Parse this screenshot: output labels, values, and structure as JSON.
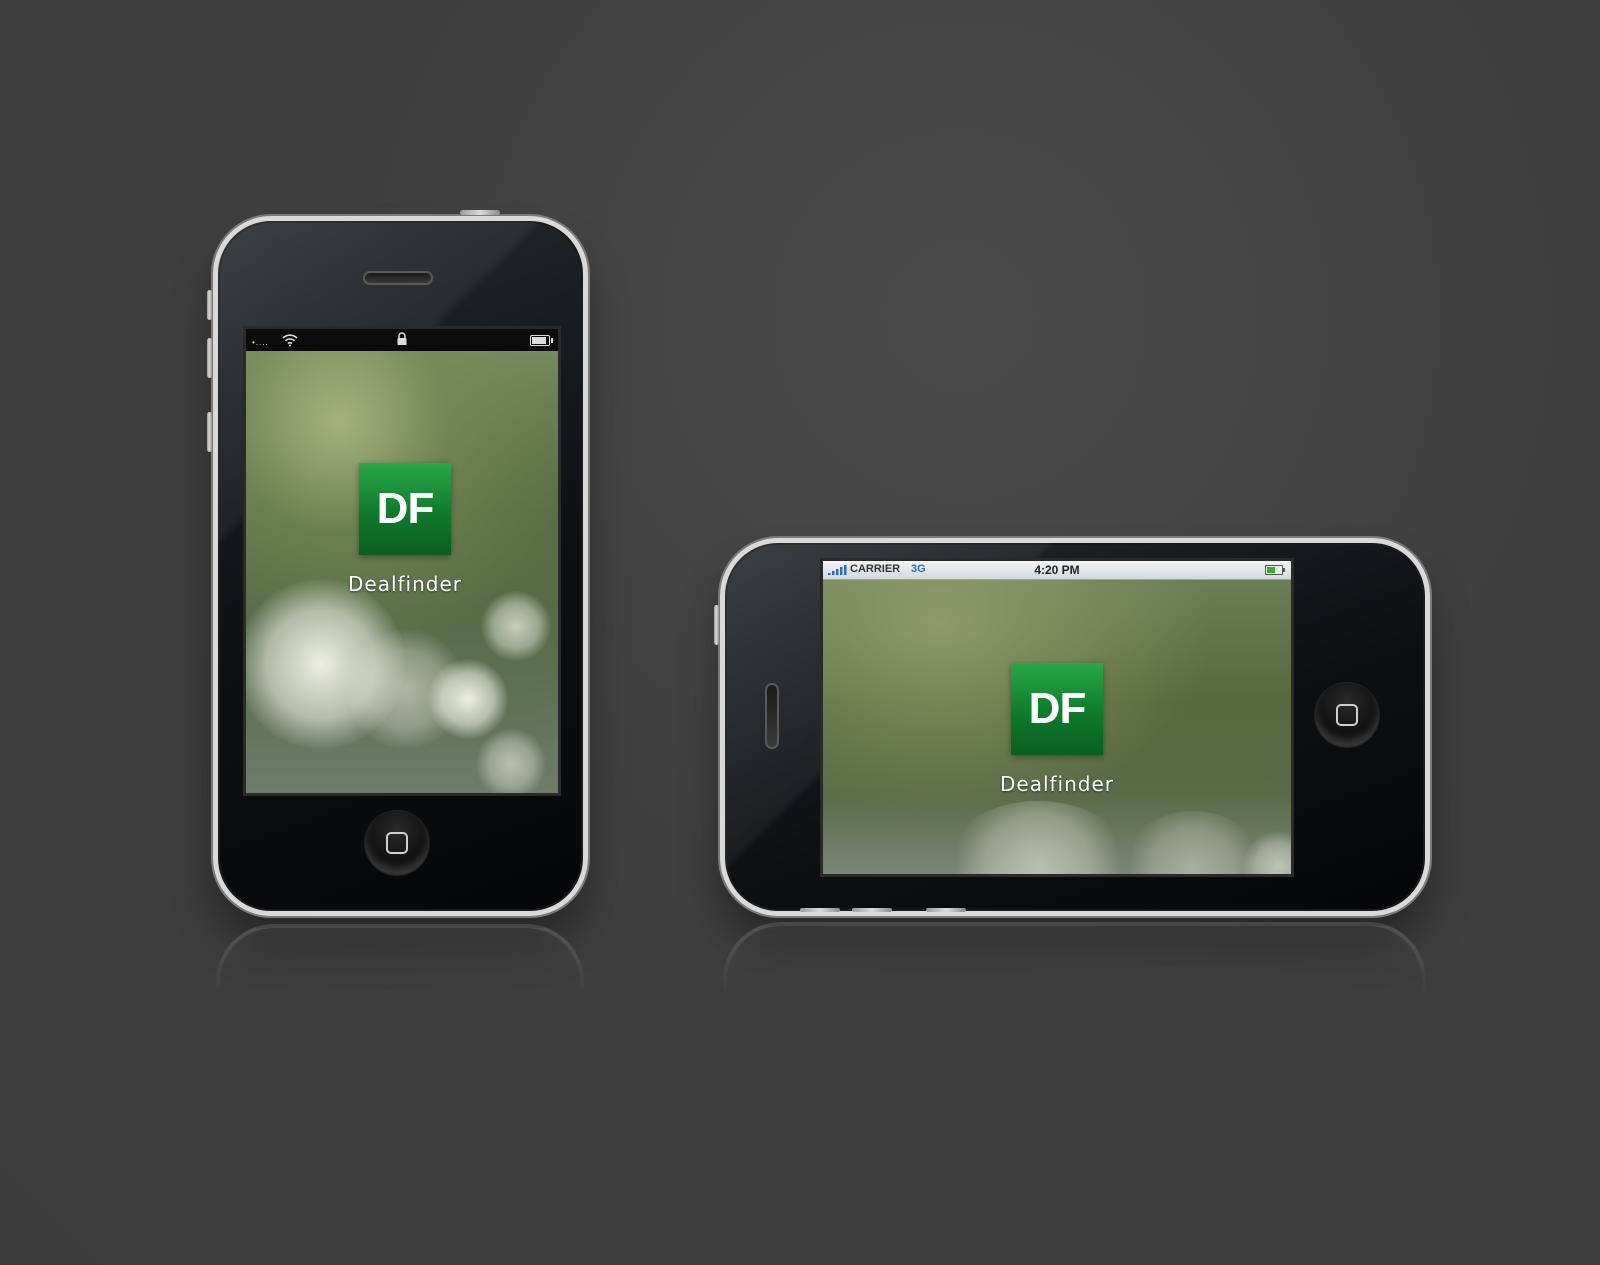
{
  "portrait": {
    "status": {
      "signal_dots": "•....",
      "icons": [
        "wifi-icon",
        "lock-icon",
        "battery-icon"
      ],
      "battery_level": 0.9
    },
    "app": {
      "icon_text": "DF",
      "label": "Dealfinder"
    }
  },
  "landscape": {
    "status": {
      "carrier": "CARRIER",
      "network": "3G",
      "time": "4:20 PM",
      "icons": [
        "signal-bars-icon",
        "battery-icon"
      ],
      "battery_level": 0.6
    },
    "app": {
      "icon_text": "DF",
      "label": "Dealfinder"
    }
  },
  "colors": {
    "background": "#3f3f3f",
    "app_icon_green": "#0f7a2c",
    "network_blue": "#2a6fc4",
    "battery_green": "#2fb52f"
  }
}
